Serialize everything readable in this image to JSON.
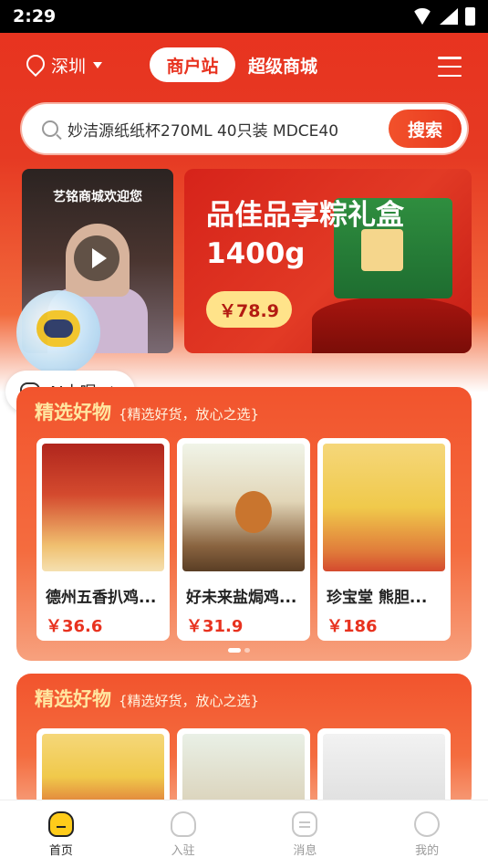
{
  "status_bar": {
    "time": "2:29"
  },
  "header": {
    "city": "深圳",
    "tab_active": "商户站",
    "tab_inactive": "超级商城"
  },
  "search": {
    "query": "妙洁源纸纸杯270ML 40只装 MDCE40",
    "button_label": "搜索"
  },
  "video": {
    "title": "艺铭商城欢迎您"
  },
  "banner": {
    "headline": "品佳品享粽礼盒1400g",
    "price": "￥78.9"
  },
  "assistant": {
    "label": "AI小喔"
  },
  "section1": {
    "title": "精选好物",
    "subtitle": "{精选好货，放心之选}",
    "products": [
      {
        "name": "德州五香扒鸡...",
        "price": "￥36.6"
      },
      {
        "name": "好未来盐焗鸡...",
        "price": "￥31.9"
      },
      {
        "name": "珍宝堂 熊胆...",
        "price": "￥186"
      }
    ]
  },
  "section2": {
    "title": "精选好物",
    "subtitle": "{精选好货，放心之选}"
  },
  "tabbar": {
    "tabs": [
      {
        "label": "首页",
        "icon": "home-icon",
        "active": true
      },
      {
        "label": "入驻",
        "icon": "heart-icon",
        "active": false
      },
      {
        "label": "消息",
        "icon": "message-icon",
        "active": false
      },
      {
        "label": "我的",
        "icon": "profile-icon",
        "active": false
      }
    ]
  },
  "colors": {
    "brand_red": "#e8321f",
    "price_red": "#e8321f",
    "title_gold": "#ffe6a0"
  }
}
